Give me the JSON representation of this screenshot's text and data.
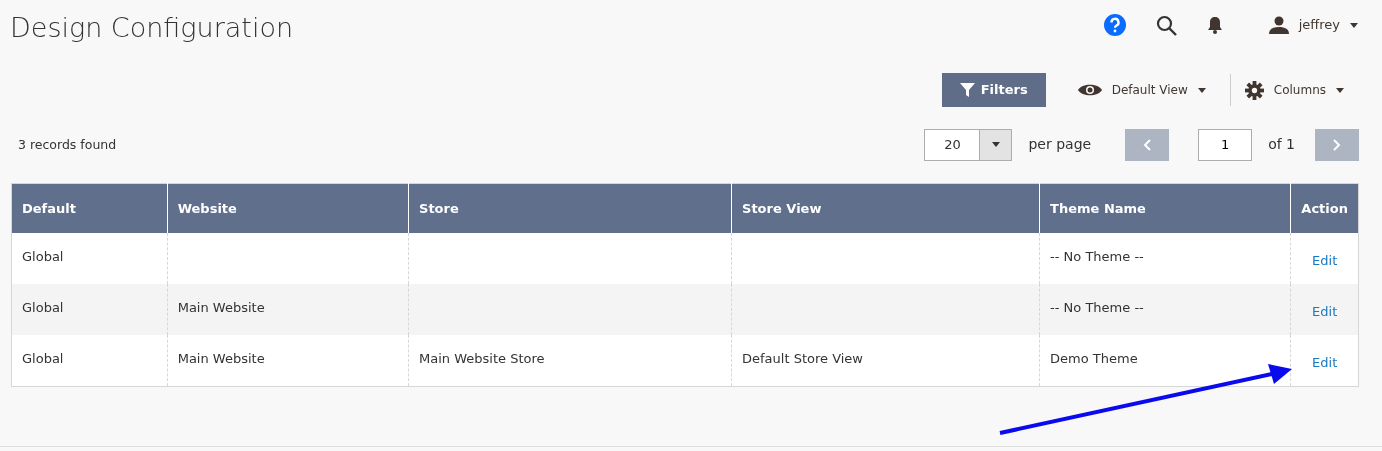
{
  "page": {
    "title": "Design Configuration"
  },
  "header": {
    "user": "jeffrey"
  },
  "toolbar": {
    "filters": "Filters",
    "view": "Default View",
    "columns": "Columns"
  },
  "grid": {
    "records": "3 records found",
    "page_size": "20",
    "per_page": "per page",
    "page": "1",
    "of_pages": "of 1"
  },
  "table": {
    "columns": [
      "Default",
      "Website",
      "Store",
      "Store View",
      "Theme Name",
      "Action"
    ],
    "rows": [
      [
        "Global",
        null,
        null,
        null,
        "-- No Theme --",
        "Edit"
      ],
      [
        "Global",
        "Main Website",
        null,
        null,
        "-- No Theme --",
        "Edit"
      ],
      [
        "Global",
        "Main Website",
        "Main Website Store",
        "Default Store View",
        "Demo Theme",
        "Edit"
      ]
    ]
  }
}
